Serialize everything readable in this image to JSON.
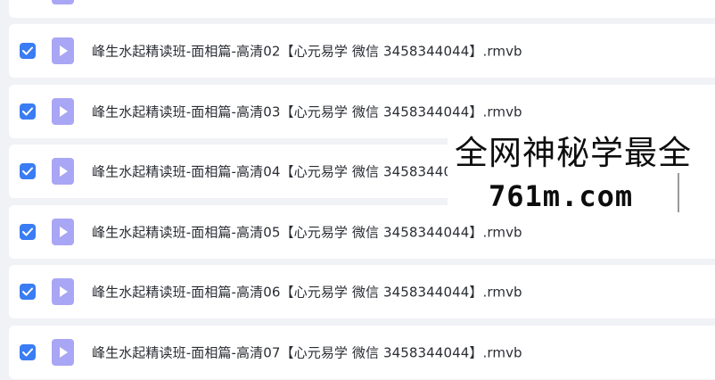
{
  "colors": {
    "page_background": "#f1f2f6",
    "row_background": "#ffffff",
    "checkbox_accent": "#3a7cf3",
    "file_icon": "#a9a6f5",
    "text": "#2a2d33"
  },
  "files": [
    {
      "name": "",
      "checked": true,
      "icon": "video-file-icon"
    },
    {
      "name": "峰生水起精读班-面相篇-高清02【心元易学 微信 3458344044】.rmvb",
      "checked": true,
      "icon": "video-file-icon"
    },
    {
      "name": "峰生水起精读班-面相篇-高清03【心元易学 微信 3458344044】.rmvb",
      "checked": true,
      "icon": "video-file-icon"
    },
    {
      "name": "峰生水起精读班-面相篇-高清04【心元易学 微信 3458344044】.rmvb",
      "checked": true,
      "icon": "video-file-icon"
    },
    {
      "name": "峰生水起精读班-面相篇-高清05【心元易学 微信 3458344044】.rmvb",
      "checked": true,
      "icon": "video-file-icon"
    },
    {
      "name": "峰生水起精读班-面相篇-高清06【心元易学 微信 3458344044】.rmvb",
      "checked": true,
      "icon": "video-file-icon"
    },
    {
      "name": "峰生水起精读班-面相篇-高清07【心元易学 微信 3458344044】.rmvb",
      "checked": true,
      "icon": "video-file-icon"
    }
  ],
  "watermark": {
    "line1": "全网神秘学最全",
    "line2": "761m.com"
  }
}
